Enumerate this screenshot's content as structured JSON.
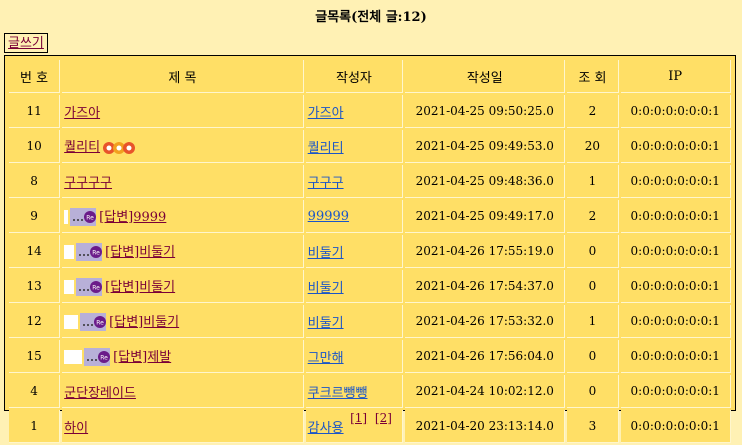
{
  "title": "글목록(전체 글:12)",
  "write_button": "글쓰기",
  "columns": [
    "번 호",
    "제 목",
    "작성자",
    "작성일",
    "조 회",
    "IP"
  ],
  "rows": [
    {
      "num": "11",
      "subject": "가즈아",
      "reply": false,
      "depth": 0,
      "hot": false,
      "writer": "가즈아",
      "date": "2021-04-25 09:50:25.0",
      "views": "2",
      "ip": "0:0:0:0:0:0:0:1"
    },
    {
      "num": "10",
      "subject": "퀄리티",
      "reply": false,
      "depth": 0,
      "hot": true,
      "writer": "퀄리티",
      "date": "2021-04-25 09:49:53.0",
      "views": "20",
      "ip": "0:0:0:0:0:0:0:1"
    },
    {
      "num": "8",
      "subject": "구구구구",
      "reply": false,
      "depth": 0,
      "hot": false,
      "writer": "구구구",
      "date": "2021-04-25 09:48:36.0",
      "views": "1",
      "ip": "0:0:0:0:0:0:0:1"
    },
    {
      "num": "9",
      "subject": "[답변]9999",
      "reply": true,
      "depth": 1,
      "hot": false,
      "writer": "99999",
      "date": "2021-04-25 09:49:17.0",
      "views": "2",
      "ip": "0:0:0:0:0:0:0:1"
    },
    {
      "num": "14",
      "subject": "[답변]비둘기",
      "reply": true,
      "depth": 2,
      "hot": false,
      "writer": "비둘기",
      "date": "2021-04-26 17:55:19.0",
      "views": "0",
      "ip": "0:0:0:0:0:0:0:1"
    },
    {
      "num": "13",
      "subject": "[답변]비둘기",
      "reply": true,
      "depth": 2,
      "hot": false,
      "writer": "비둘기",
      "date": "2021-04-26 17:54:37.0",
      "views": "0",
      "ip": "0:0:0:0:0:0:0:1"
    },
    {
      "num": "12",
      "subject": "[답변]비둘기",
      "reply": true,
      "depth": 3,
      "hot": false,
      "writer": "비둘기",
      "date": "2021-04-26 17:53:32.0",
      "views": "1",
      "ip": "0:0:0:0:0:0:0:1"
    },
    {
      "num": "15",
      "subject": "[답변]제발",
      "reply": true,
      "depth": 4,
      "hot": false,
      "writer": "그만해",
      "date": "2021-04-26 17:56:04.0",
      "views": "0",
      "ip": "0:0:0:0:0:0:0:1"
    },
    {
      "num": "4",
      "subject": "군단장레이드",
      "reply": false,
      "depth": 0,
      "hot": false,
      "writer": "쿠크르뺑뺑",
      "date": "2021-04-24 10:02:12.0",
      "views": "0",
      "ip": "0:0:0:0:0:0:0:1"
    },
    {
      "num": "1",
      "subject": "하이",
      "reply": false,
      "depth": 0,
      "hot": false,
      "writer": "감사용",
      "date": "2021-04-20 23:13:14.0",
      "views": "3",
      "ip": "0:0:0:0:0:0:0:1"
    }
  ],
  "pager": [
    "[1]",
    "[2]"
  ],
  "colors": {
    "background": "#FFF1B4",
    "table": "#FFDF66",
    "subject_link": "#7a0037",
    "writer_link": "#1a55c8"
  }
}
